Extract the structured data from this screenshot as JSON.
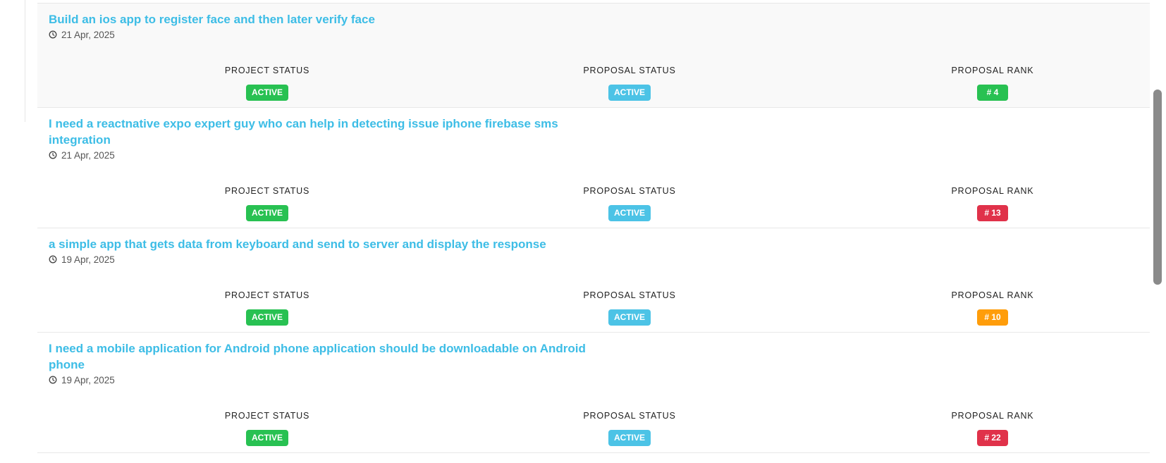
{
  "projects": [
    {
      "title": "Build an ios app to register face and then later verify face",
      "date": "21 Apr, 2025",
      "project_status_label": "PROJECT STATUS",
      "project_status": "ACTIVE",
      "proposal_status_label": "PROPOSAL STATUS",
      "proposal_status": "ACTIVE",
      "proposal_rank_label": "PROPOSAL RANK",
      "proposal_rank": "# 4",
      "rank_color": "#28c152"
    },
    {
      "title": "I need a reactnative expo expert guy who can help in detecting issue iphone firebase sms integration",
      "date": "21 Apr, 2025",
      "project_status_label": "PROJECT STATUS",
      "project_status": "ACTIVE",
      "proposal_status_label": "PROPOSAL STATUS",
      "proposal_status": "ACTIVE",
      "proposal_rank_label": "PROPOSAL RANK",
      "proposal_rank": "# 13",
      "rank_color": "#e0324a"
    },
    {
      "title": "a simple app that gets data from keyboard and send to server and display the response",
      "date": "19 Apr, 2025",
      "project_status_label": "PROJECT STATUS",
      "project_status": "ACTIVE",
      "proposal_status_label": "PROPOSAL STATUS",
      "proposal_status": "ACTIVE",
      "proposal_rank_label": "PROPOSAL RANK",
      "proposal_rank": "# 10",
      "rank_color": "#ff9d0a"
    },
    {
      "title": "I need a mobile application for Android phone application should be downloadable on Android phone",
      "date": "19 Apr, 2025",
      "project_status_label": "PROJECT STATUS",
      "project_status": "ACTIVE",
      "proposal_status_label": "PROPOSAL STATUS",
      "proposal_status": "ACTIVE",
      "proposal_rank_label": "PROPOSAL RANK",
      "proposal_rank": "# 22",
      "rank_color": "#e0324a"
    }
  ],
  "colors": {
    "project_status_bg": "#28c152",
    "proposal_status_bg": "#4cc3e6",
    "title_link": "#3dbde6"
  },
  "icons": {
    "date_icon": "clock-icon"
  }
}
